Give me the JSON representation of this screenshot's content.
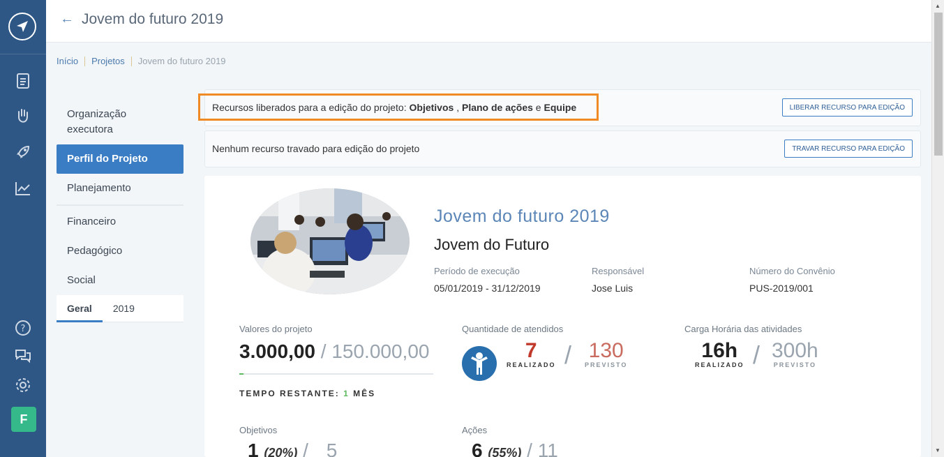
{
  "header": {
    "title": "Jovem do futuro 2019"
  },
  "breadcrumb": [
    "Início",
    "Projetos",
    "Jovem do futuro 2019"
  ],
  "menu": {
    "items": [
      "Organização executora",
      "Perfil do Projeto",
      "Planejamento",
      "Financeiro",
      "Pedagógico",
      "Social"
    ],
    "tabs": [
      "Geral",
      "2019"
    ]
  },
  "resources": {
    "released_prefix": "Recursos liberados para a edição do projeto: ",
    "released_1": "Objetivos",
    "released_sep1": " , ",
    "released_2": "Plano de ações",
    "released_sep2": " e ",
    "released_3": "Equipe",
    "release_button": "LIBERAR RECURSO PARA EDIÇÃO",
    "locked_text": "Nenhum recurso travado para edição do projeto",
    "lock_button": "TRAVAR RECURSO PARA EDIÇÃO"
  },
  "project": {
    "title": "Jovem do futuro 2019",
    "subtitle": "Jovem do Futuro",
    "period_label": "Período de execução",
    "period_value": "05/01/2019 - 31/12/2019",
    "responsible_label": "Responsável",
    "responsible_value": "Jose Luis",
    "agreement_label": "Número do Convênio",
    "agreement_value": "PUS-2019/001"
  },
  "stats": {
    "values_label": "Valores do projeto",
    "values_realized": "3.000,00",
    "values_slash": "/",
    "values_planned": "150.000,00",
    "values_progress": 0.02,
    "time_label": "TEMPO RESTANTE: ",
    "time_number": "1",
    "time_unit": " MÊS",
    "attendees_label": "Quantidade de atendidos",
    "attendees_realized": "7",
    "attendees_planned": "130",
    "hours_label": "Carga Horária das atividades",
    "hours_realized": "16h",
    "hours_planned": "300h",
    "realized_caption": "REALIZADO",
    "planned_caption": "PREVISTO",
    "slash": "/",
    "objectives_label": "Objetivos",
    "objectives_realized": "1",
    "objectives_pct": "(20%)",
    "objectives_planned": "5",
    "actions_label": "Ações",
    "actions_realized": "6",
    "actions_pct": "(55%)",
    "actions_planned": "11"
  },
  "rail": {
    "avatar_letter": "F"
  },
  "colors": {
    "rail": "#2e5785",
    "accent": "#3b7dc4",
    "highlight": "#f08a24",
    "realized_red": "#c0392b",
    "planned_red": "#c96b5e"
  }
}
